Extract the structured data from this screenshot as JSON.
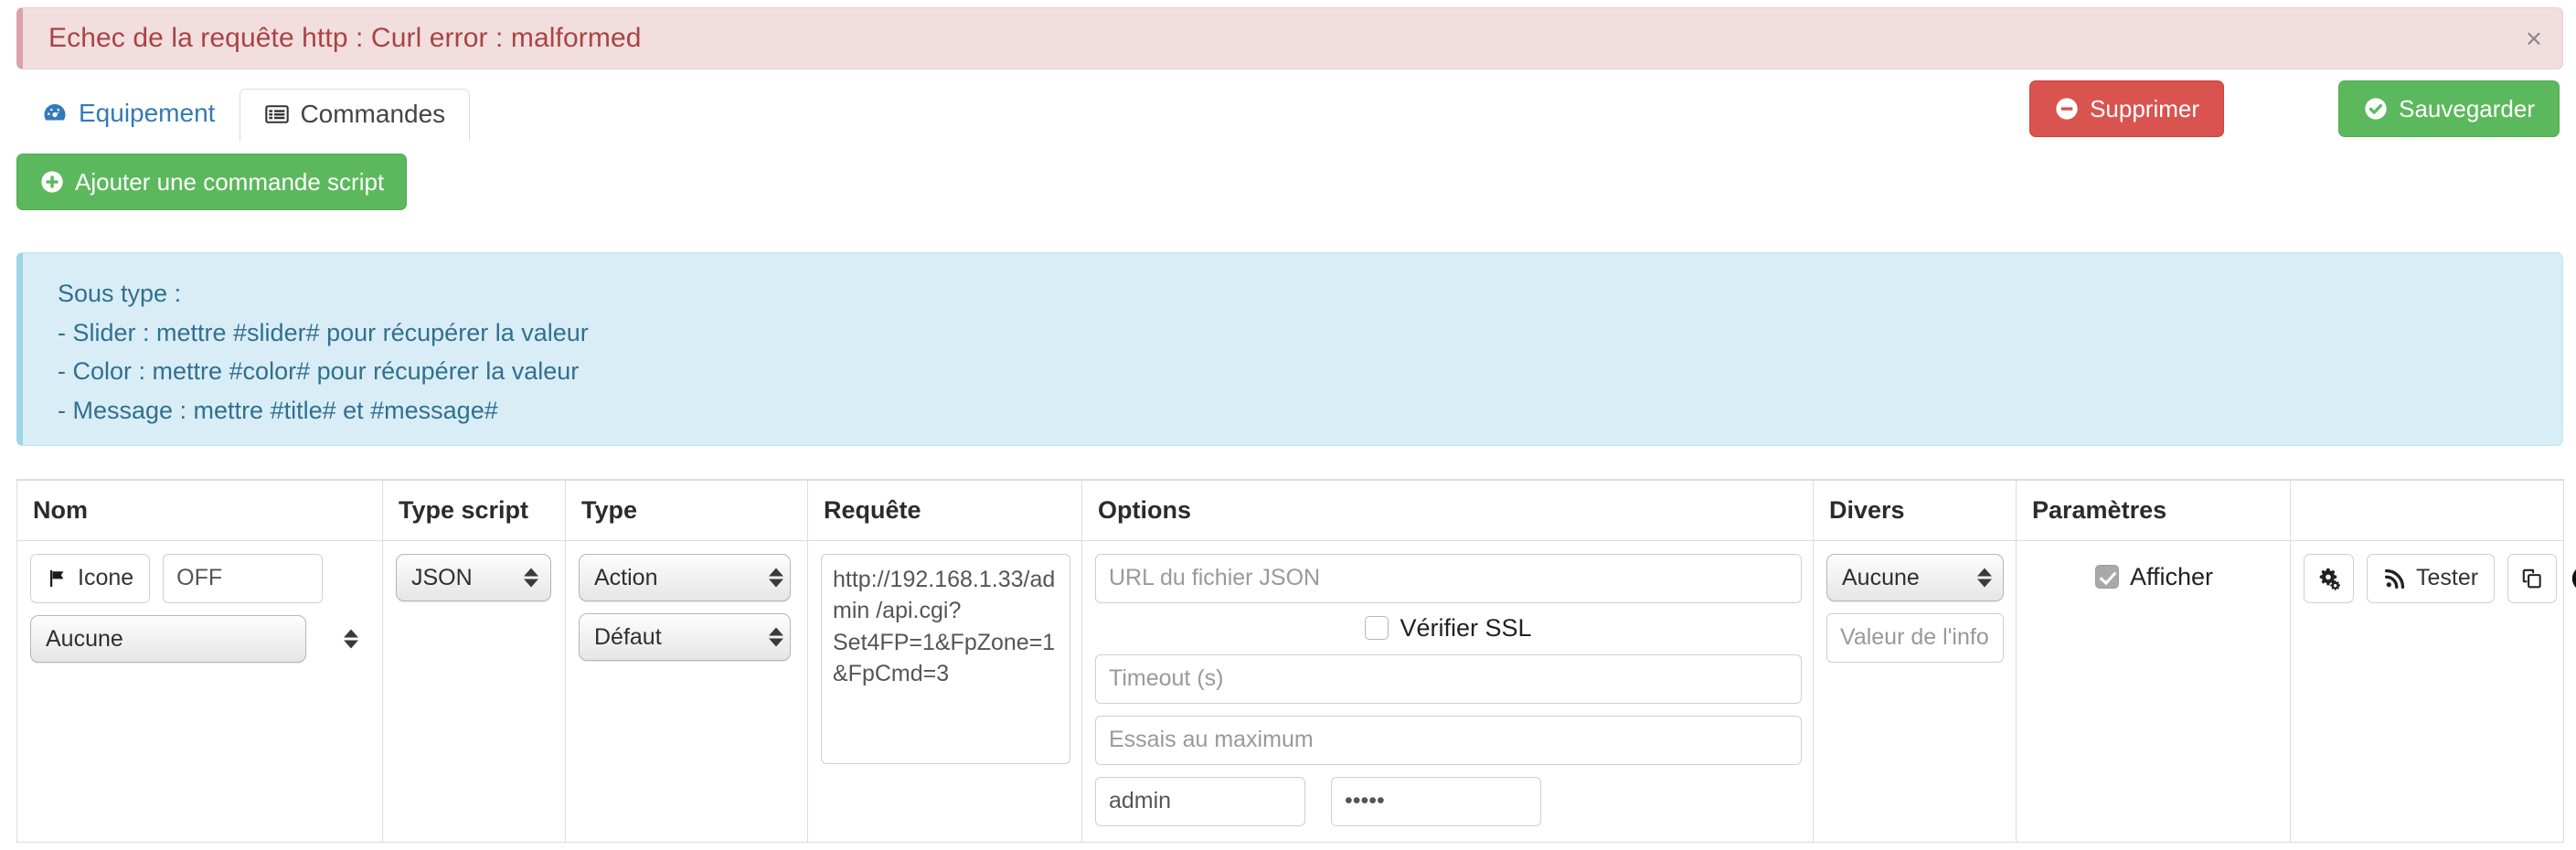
{
  "alert": {
    "message": "Echec de la requête http : Curl error : malformed",
    "close_label": "×",
    "bg_color": "#f2dede",
    "text_color": "#a94442"
  },
  "tabs": [
    {
      "label": "Equipement",
      "icon": "tachometer-icon",
      "active": false
    },
    {
      "label": "Commandes",
      "icon": "list-alt-icon",
      "active": true
    }
  ],
  "toolbar": {
    "delete_label": "Supprimer",
    "delete_icon": "minus-circle-icon",
    "delete_color": "#d9534f",
    "save_label": "Sauvegarder",
    "save_icon": "check-circle-icon",
    "save_color": "#5cb85c",
    "add_label": "Ajouter une commande script",
    "add_icon": "plus-circle-icon"
  },
  "info_panel": {
    "title": "Sous type :",
    "lines": [
      "- Slider : mettre #slider# pour récupérer la valeur",
      "- Color : mettre #color# pour récupérer la valeur",
      "- Message : mettre #title# et #message#"
    ],
    "bg_color": "#d9edf7",
    "text_color": "#31708f"
  },
  "table": {
    "headers": [
      "Nom",
      "Type script",
      "Type",
      "Requête",
      "Options",
      "Divers",
      "Paramètres",
      ""
    ],
    "row": {
      "nom": {
        "icon_button_label": "Icone",
        "icon_button_icon": "flag-icon",
        "name_value": "OFF",
        "name_placeholder": "",
        "select_value": "Aucune"
      },
      "type_script": {
        "select_value": "JSON"
      },
      "type": {
        "select_value": "Action",
        "subtype_select_value": "Défaut"
      },
      "requete": {
        "value": "http://192.168.1.33/admin /api.cgi?Set4FP=1&FpZone=1&FpCmd=3"
      },
      "options": {
        "json_url_placeholder": "URL du fichier JSON",
        "json_url_value": "",
        "verify_ssl_label": "Vérifier SSL",
        "verify_ssl_checked": false,
        "timeout_placeholder": "Timeout (s)",
        "timeout_value": "",
        "max_retry_placeholder": "Essais au maximum",
        "max_retry_value": "",
        "user_value": "admin",
        "user_placeholder": "",
        "password_value": "•••••",
        "password_placeholder": ""
      },
      "divers": {
        "select_value": "Aucune",
        "info_value_placeholder": "Valeur de l'info",
        "info_value": ""
      },
      "parametres": {
        "display_label": "Afficher",
        "display_checked": true
      },
      "actions": {
        "config_icon": "cogs-icon",
        "test_label": "Tester",
        "test_icon": "rss-icon",
        "clone_icon": "clone-icon",
        "remove_icon": "minus-circle-icon"
      }
    }
  }
}
